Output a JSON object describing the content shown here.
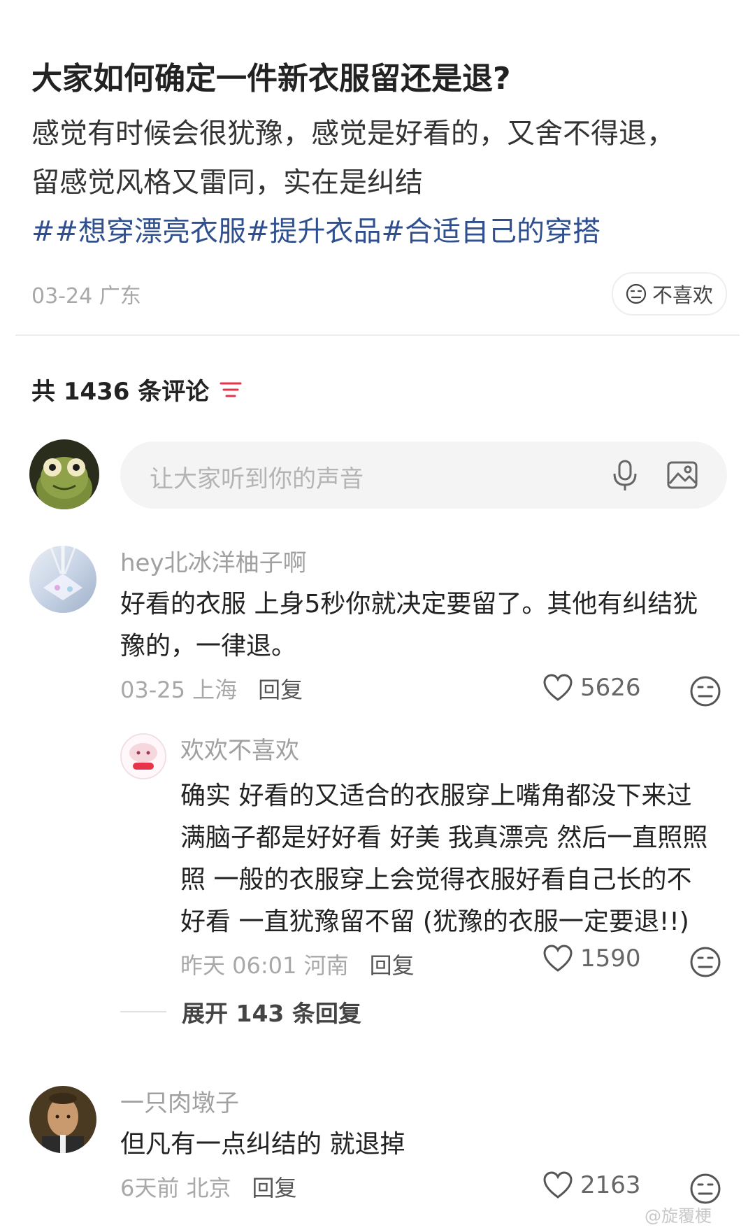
{
  "post": {
    "title": "大家如何确定一件新衣服留还是退?",
    "body_line1": "感觉有时候会很犹豫，感觉是好看的，又舍不得退，",
    "body_line2": "留感觉风格又雷同，实在是纠结",
    "tags": [
      "##想穿漂亮衣服",
      "#提升衣品",
      "#合适自己的穿搭"
    ],
    "date_location": "03-24 广东",
    "dislike_label": "不喜欢"
  },
  "comments_header": {
    "count_text": "共 1436 条评论",
    "sort_icon": "filter-lines-icon"
  },
  "comment_input": {
    "placeholder": "让大家听到你的声音",
    "mic_icon": "microphone-icon",
    "image_icon": "image-icon"
  },
  "comments": [
    {
      "user": "hey北冰洋柚子啊",
      "text_line1": "好看的衣服 上身5秒你就决定要留了。其他有纠结犹",
      "text_line2": "豫的，一律退。",
      "date_location": "03-25 上海",
      "reply_label": "回复",
      "likes": "5626",
      "reply": {
        "user": "欢欢不喜欢",
        "text_line1": "确实 好看的又适合的衣服穿上嘴角都没下来过",
        "text_line2": "满脑子都是好好看 好美 我真漂亮 然后一直照照",
        "text_line3": "照  一般的衣服穿上会觉得衣服好看自己长的不",
        "text_line4": "好看 一直犹豫留不留 (犹豫的衣服一定要退!!)",
        "date_location": "昨天 06:01 河南",
        "reply_label": "回复",
        "likes": "1590"
      },
      "expand_label": "展开 143 条回复"
    },
    {
      "user": "一只肉墩子",
      "text_line1": "但凡有一点纠结的 就退掉",
      "date_location": "6天前 北京",
      "reply_label": "回复",
      "likes": "2163"
    }
  ],
  "watermark": "@旋覆梗",
  "colors": {
    "tag_blue": "#2f4f8f",
    "sort_red": "#e8344b",
    "muted_gray": "#a8a8a8",
    "input_bg": "#f4f4f4"
  }
}
